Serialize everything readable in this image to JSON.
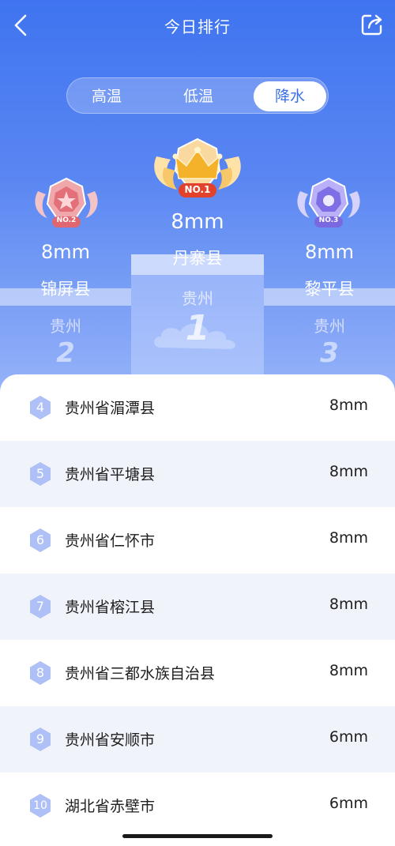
{
  "header": {
    "title": "今日排行"
  },
  "tabs": [
    {
      "label": "高温",
      "active": false
    },
    {
      "label": "低温",
      "active": false
    },
    {
      "label": "降水",
      "active": true
    }
  ],
  "podium": {
    "first": {
      "badge": "NO.1",
      "value": "8mm",
      "name": "丹寨县",
      "region": "贵州",
      "rank": "1"
    },
    "second": {
      "badge": "NO.2",
      "value": "8mm",
      "name": "锦屏县",
      "region": "贵州",
      "rank": "2"
    },
    "third": {
      "badge": "NO.3",
      "value": "8mm",
      "name": "黎平县",
      "region": "贵州",
      "rank": "3"
    }
  },
  "list": [
    {
      "rank": "4",
      "name": "贵州省湄潭县",
      "value": "8mm"
    },
    {
      "rank": "5",
      "name": "贵州省平塘县",
      "value": "8mm"
    },
    {
      "rank": "6",
      "name": "贵州省仁怀市",
      "value": "8mm"
    },
    {
      "rank": "7",
      "name": "贵州省榕江县",
      "value": "8mm"
    },
    {
      "rank": "8",
      "name": "贵州省三都水族自治县",
      "value": "8mm"
    },
    {
      "rank": "9",
      "name": "贵州省安顺市",
      "value": "6mm"
    },
    {
      "rank": "10",
      "name": "湖北省赤壁市",
      "value": "6mm"
    }
  ],
  "colors": {
    "accent": "#3b6fe8",
    "hex_badge": "#a9bdf5",
    "gold": "#f3b43a",
    "rose": "#e88a8f",
    "violet": "#9a8ef0"
  },
  "icons": {
    "back": "chevron-left-icon",
    "share": "share-icon"
  }
}
